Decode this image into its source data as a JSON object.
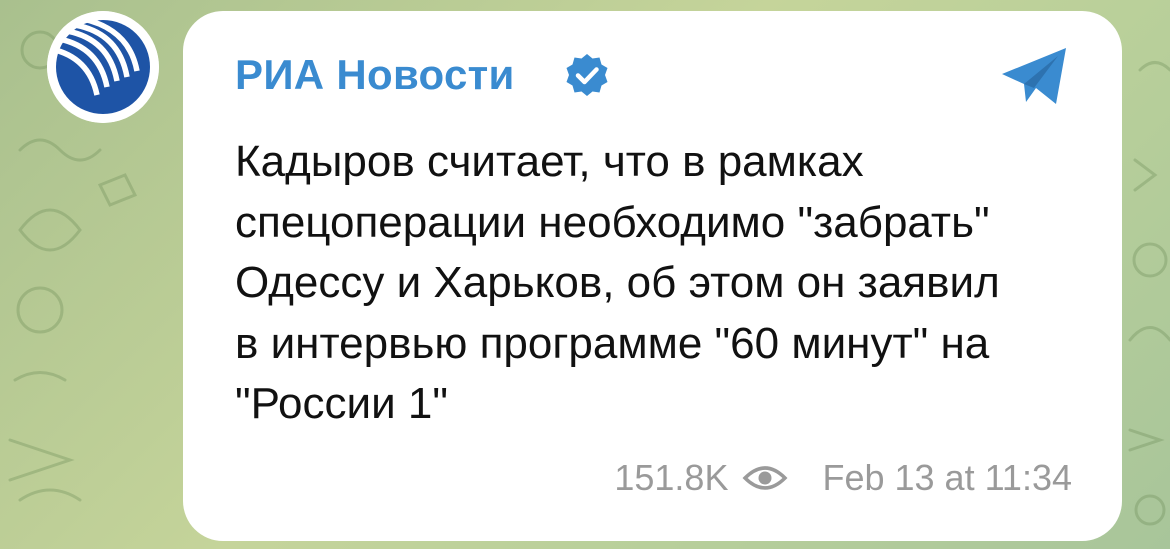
{
  "channel": {
    "name": "РИА Новости",
    "verified": true,
    "avatar_icon": "ria-logo-icon"
  },
  "post": {
    "text": "Кадыров считает, что в рамках\nспецоперации необходимо \"забрать\"\nОдессу и Харьков, об этом он заявил\nв интервью программе \"60 минут\" на\n\"России 1\"",
    "views": "151.8K",
    "timestamp": "Feb 13 at 11:34"
  },
  "icons": {
    "verified": "verified-badge-icon",
    "share": "telegram-share-icon",
    "views": "eye-icon"
  },
  "colors": {
    "accent": "#3a8bd0",
    "logo_blue": "#1e54a6",
    "meta_text": "#9a9a9a",
    "bubble": "#ffffff",
    "background": "#b8cf9a"
  }
}
